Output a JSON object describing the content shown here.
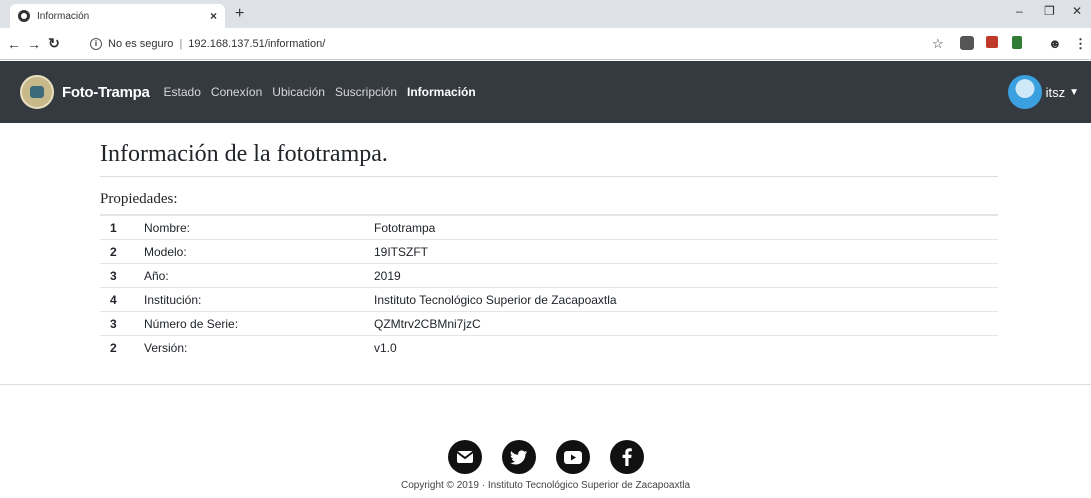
{
  "browser": {
    "tab_title": "Información",
    "tab_close": "×",
    "new_tab": "+",
    "security_label": "No es seguro",
    "url": "192.168.137.51/information/"
  },
  "navbar": {
    "brand": "Foto-Trampa",
    "items": [
      {
        "label": "Estado"
      },
      {
        "label": "Conexíon"
      },
      {
        "label": "Ubicación"
      },
      {
        "label": "Suscripción"
      },
      {
        "label": "Información"
      }
    ],
    "active_index": 4,
    "user": "itsz"
  },
  "main": {
    "title": "Información de la fototrampa.",
    "section": "Propiedades:",
    "rows": [
      {
        "idx": "1",
        "key": "Nombre:",
        "value": "Fototrampa"
      },
      {
        "idx": "2",
        "key": "Modelo:",
        "value": "19ITSZFT"
      },
      {
        "idx": "3",
        "key": "Año:",
        "value": "2019"
      },
      {
        "idx": "4",
        "key": "Institución:",
        "value": "Instituto Tecnológico Superior de Zacapoaxtla"
      },
      {
        "idx": "3",
        "key": "Número de Serie:",
        "value": "QZMtrv2CBMni7jzC"
      },
      {
        "idx": "2",
        "key": "Versión:",
        "value": "v1.0"
      }
    ]
  },
  "footer": {
    "icons": [
      "envelope-icon",
      "twitter-icon",
      "youtube-icon",
      "facebook-icon"
    ],
    "copyright": "Copyright © 2019 · Instituto Tecnológico Superior de Zacapoaxtla"
  },
  "colors": {
    "navbar_bg": "#343a40",
    "text": "#212529"
  }
}
